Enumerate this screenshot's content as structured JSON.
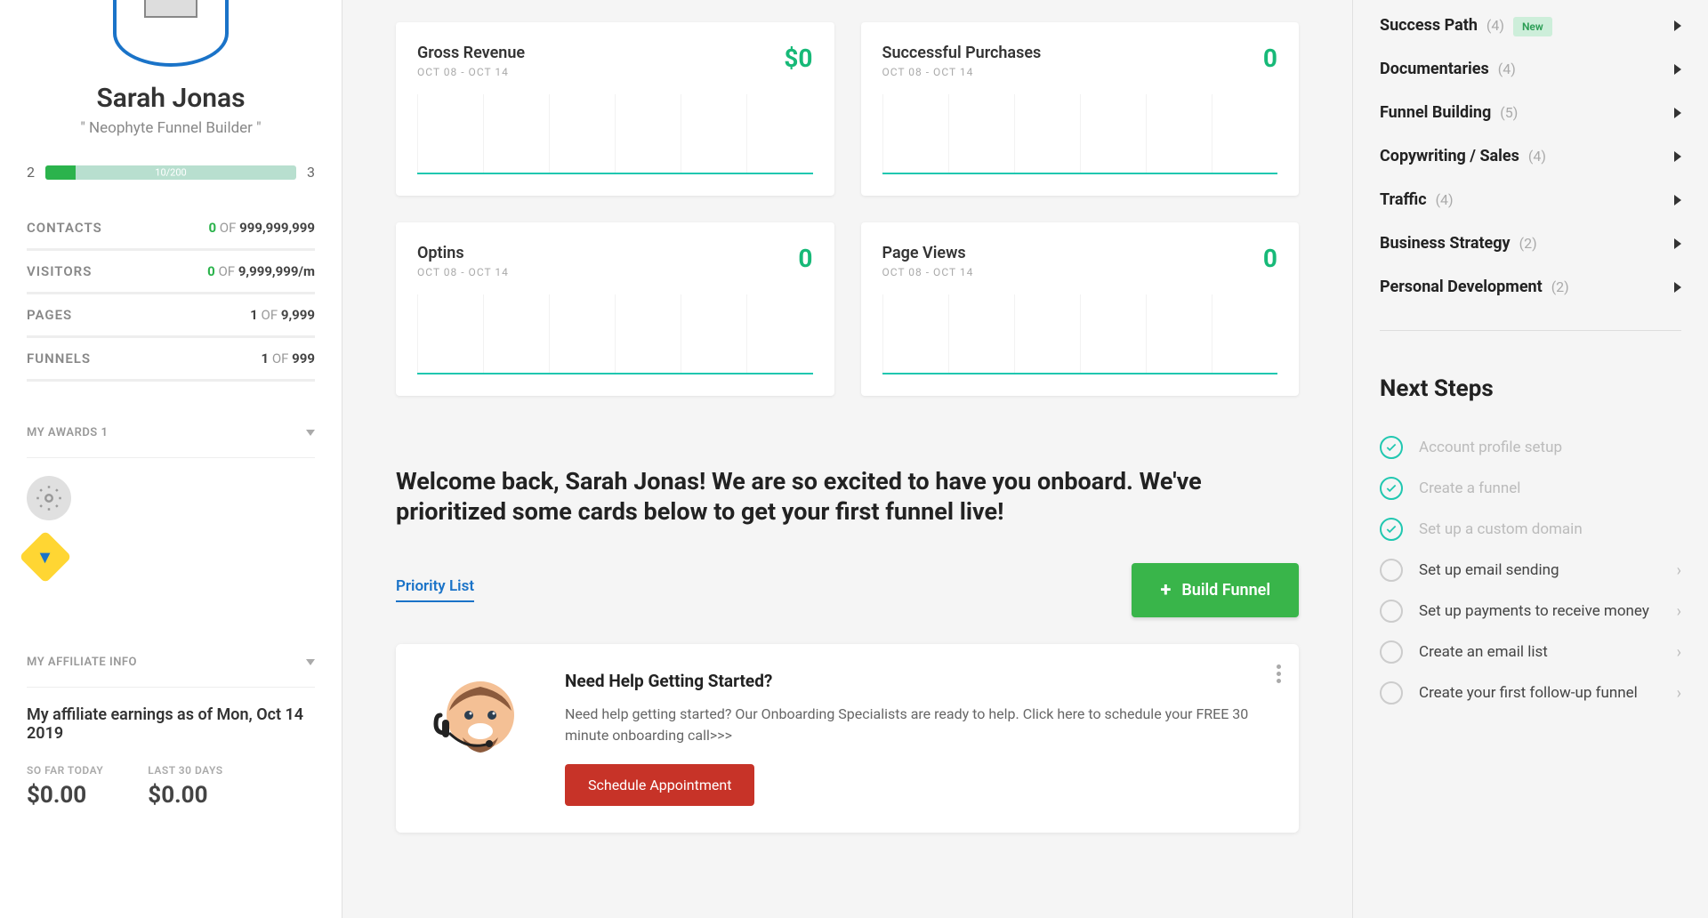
{
  "user": {
    "name": "Sarah Jonas",
    "title": "\" Neophyte Funnel Builder \"",
    "level_from": "2",
    "level_to": "3",
    "progress_label": "10/200"
  },
  "stats": {
    "contacts": {
      "label": "CONTACTS",
      "value": "0",
      "of": "OF",
      "max": "999,999,999"
    },
    "visitors": {
      "label": "VISITORS",
      "value": "0",
      "of": "OF",
      "max": "9,999,999/m"
    },
    "pages": {
      "label": "PAGES",
      "value": "1",
      "of": "OF",
      "max": "9,999"
    },
    "funnels": {
      "label": "FUNNELS",
      "value": "1",
      "of": "OF",
      "max": "999"
    }
  },
  "sections": {
    "awards": "MY AWARDS 1",
    "affiliate": "MY AFFILIATE INFO"
  },
  "affiliate": {
    "heading": "My affiliate earnings as of Mon, Oct 14 2019",
    "today_label": "SO FAR TODAY",
    "today_value": "$0.00",
    "last30_label": "LAST 30 DAYS",
    "last30_value": "$0.00"
  },
  "metrics": {
    "range": "OCT 08 - OCT 14",
    "revenue": {
      "title": "Gross Revenue",
      "value": "$0"
    },
    "purchases": {
      "title": "Successful Purchases",
      "value": "0"
    },
    "optins": {
      "title": "Optins",
      "value": "0"
    },
    "pageviews": {
      "title": "Page Views",
      "value": "0"
    }
  },
  "welcome": "Welcome back, Sarah Jonas! We are so excited to have you onboard. We've prioritized some cards below to get your first funnel live!",
  "priority_label": "Priority List",
  "build_funnel_label": "Build Funnel",
  "help_card": {
    "title": "Need Help Getting Started?",
    "body": "Need help getting started? Our Onboarding Specialists are ready to help. Click here to schedule your FREE 30 minute onboarding call>>>",
    "cta": "Schedule Appointment"
  },
  "categories": [
    {
      "label": "Success Path",
      "count": "(4)",
      "new": true
    },
    {
      "label": "Documentaries",
      "count": "(4)",
      "new": false
    },
    {
      "label": "Funnel Building",
      "count": "(5)",
      "new": false
    },
    {
      "label": "Copywriting / Sales",
      "count": "(4)",
      "new": false
    },
    {
      "label": "Traffic",
      "count": "(4)",
      "new": false
    },
    {
      "label": "Business Strategy",
      "count": "(2)",
      "new": false
    },
    {
      "label": "Personal Development",
      "count": "(2)",
      "new": false
    }
  ],
  "new_badge_text": "New",
  "next_steps_title": "Next Steps",
  "next_steps": [
    {
      "text": "Account profile setup",
      "done": true
    },
    {
      "text": "Create a funnel",
      "done": true
    },
    {
      "text": "Set up a custom domain",
      "done": true
    },
    {
      "text": "Set up email sending",
      "done": false
    },
    {
      "text": "Set up payments to receive money",
      "done": false
    },
    {
      "text": "Create an email list",
      "done": false
    },
    {
      "text": "Create your first follow-up funnel",
      "done": false
    }
  ]
}
